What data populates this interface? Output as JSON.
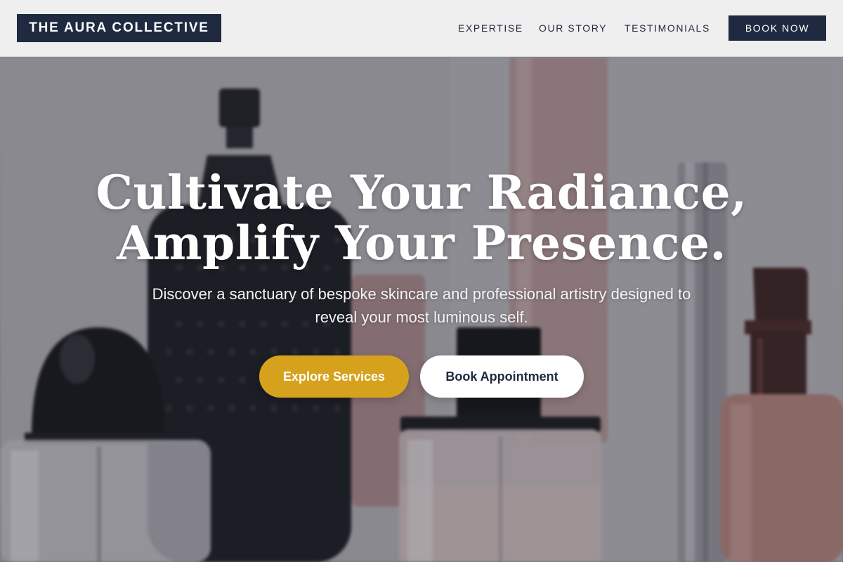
{
  "header": {
    "logo": "THE AURA COLLECTIVE",
    "nav": [
      {
        "label": "EXPERTISE"
      },
      {
        "label": "OUR STORY"
      },
      {
        "label": "TESTIMONIALS"
      }
    ],
    "cta_label": "BOOK NOW"
  },
  "hero": {
    "headline_line1": "Cultivate Your Radiance,",
    "headline_line2": "Amplify Your Presence.",
    "subheading": "Discover a sanctuary of bespoke skincare and professional artistry designed to reveal your most luminous self.",
    "primary_button": "Explore Services",
    "secondary_button": "Book Appointment"
  },
  "colors": {
    "brand_navy": "#1f2a40",
    "accent_gold": "#d6a21d",
    "header_bg": "#efefef"
  }
}
